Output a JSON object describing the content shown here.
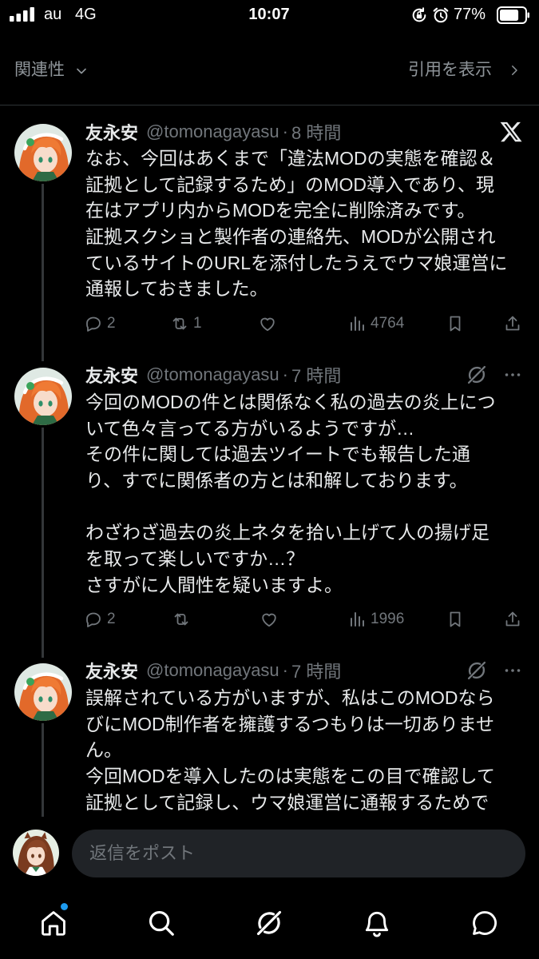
{
  "status_bar": {
    "carrier": "au",
    "network": "4G",
    "time": "10:07",
    "battery": "77%",
    "battery_level": 0.77,
    "icons": [
      "signal-icon",
      "rotation-lock-icon",
      "alarm-icon",
      "battery-icon"
    ]
  },
  "header": {
    "sort_label": "関連性",
    "quotes_label": "引用を表示"
  },
  "separator": "·",
  "tweets": [
    {
      "name": "友永安",
      "handle": "@tomonagayasu",
      "time": "8 時間",
      "top_right_icon": "x-logo-icon",
      "lines": [
        "なお、今回はあくまで「違法MODの実態を確認＆",
        "証拠として記録するため」のMOD導入であり、現",
        "在はアプリ内からMODを完全に削除済みです。",
        "証拠スクショと製作者の連絡先、MODが公開され",
        "ているサイトのURLを添付したうえでウマ娘運営に",
        "通報しておきました。"
      ],
      "replies": "2",
      "reposts": "1",
      "views": "4764"
    },
    {
      "name": "友永安",
      "handle": "@tomonagayasu",
      "time": "7 時間",
      "top_right_icon": "grok-icon",
      "lines": [
        "今回のMODの件とは関係なく私の過去の炎上につ",
        "いて色々言ってる方がいるようですが…",
        "その件に関しては過去ツイートでも報告した通",
        "り、すでに関係者の方とは和解しております。",
        "",
        "わざわざ過去の炎上ネタを拾い上げて人の揚げ足",
        "を取って楽しいですか…？",
        "さすがに人間性を疑いますよ。"
      ],
      "replies": "2",
      "views": "1996"
    },
    {
      "name": "友永安",
      "handle": "@tomonagayasu",
      "time": "7 時間",
      "top_right_icon": "grok-icon",
      "lines": [
        "誤解されている方がいますが、私はこのMODなら",
        "びにMOD制作者を擁護するつもりは一切ありませ",
        "ん。",
        "今回MODを導入したのは実態をこの目で確認して",
        "証拠として記録し、ウマ娘運営に通報するためで"
      ]
    }
  ],
  "composer": {
    "placeholder": "返信をポスト"
  },
  "nav": {
    "items": [
      {
        "icon": "home-icon",
        "active": true,
        "notification_dot": true
      },
      {
        "icon": "search-icon"
      },
      {
        "icon": "grok-icon"
      },
      {
        "icon": "notifications-icon"
      },
      {
        "icon": "messages-icon"
      }
    ]
  },
  "colors": {
    "background": "#000000",
    "text": "#e7e9ea",
    "secondary_text": "#71767b",
    "divider": "#2f3336",
    "accent": "#1d9bf0",
    "composer_background": "#202327"
  }
}
